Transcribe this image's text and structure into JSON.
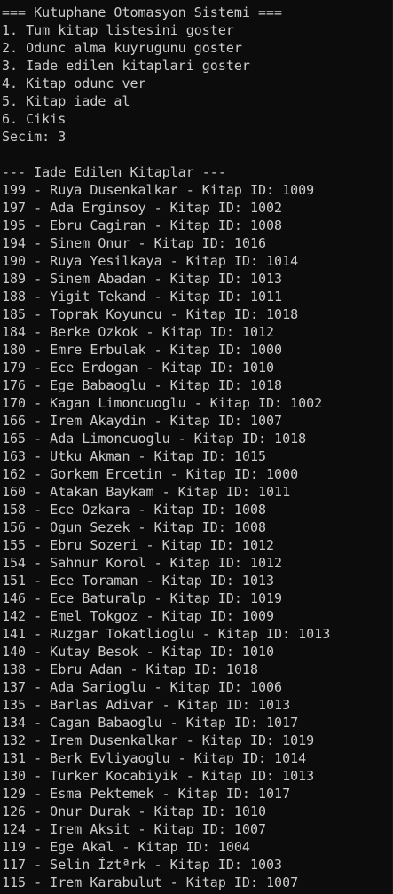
{
  "console": {
    "header": "=== Kutuphane Otomasyon Sistemi ===",
    "menu": [
      "1. Tum kitap listesini goster",
      "2. Odunc alma kuyrugunu goster",
      "3. Iade edilen kitaplari goster",
      "4. Kitap odunc ver",
      "5. Kitap iade al",
      "6. Cikis"
    ],
    "prompt": "Secim: 3",
    "section_title": "--- Iade Edilen Kitaplar ---",
    "returned_books": [
      "199 - Ruya Dusenkalkar - Kitap ID: 1009",
      "197 - Ada Erginsoy - Kitap ID: 1002",
      "195 - Ebru Cagiran - Kitap ID: 1008",
      "194 - Sinem Onur - Kitap ID: 1016",
      "190 - Ruya Yesilkaya - Kitap ID: 1014",
      "189 - Sinem Abadan - Kitap ID: 1013",
      "188 - Yigit Tekand - Kitap ID: 1011",
      "185 - Toprak Koyuncu - Kitap ID: 1018",
      "184 - Berke Ozkok - Kitap ID: 1012",
      "180 - Emre Erbulak - Kitap ID: 1000",
      "179 - Ece Erdogan - Kitap ID: 1010",
      "176 - Ege Babaoglu - Kitap ID: 1018",
      "170 - Kagan Limoncuoglu - Kitap ID: 1002",
      "166 - Irem Akaydin - Kitap ID: 1007",
      "165 - Ada Limoncuoglu - Kitap ID: 1018",
      "163 - Utku Akman - Kitap ID: 1015",
      "162 - Gorkem Ercetin - Kitap ID: 1000",
      "160 - Atakan Baykam - Kitap ID: 1011",
      "158 - Ece Ozkara - Kitap ID: 1008",
      "156 - Ogun Sezek - Kitap ID: 1008",
      "155 - Ebru Sozeri - Kitap ID: 1012",
      "154 - Sahnur Korol - Kitap ID: 1012",
      "151 - Ece Toraman - Kitap ID: 1013",
      "146 - Ece Baturalp - Kitap ID: 1019",
      "142 - Emel Tokgoz - Kitap ID: 1009",
      "141 - Ruzgar Tokatlioglu - Kitap ID: 1013",
      "140 - Kutay Besok - Kitap ID: 1010",
      "138 - Ebru Adan - Kitap ID: 1018",
      "137 - Ada Sarioglu - Kitap ID: 1006",
      "135 - Barlas Adivar - Kitap ID: 1013",
      "134 - Cagan Babaoglu - Kitap ID: 1017",
      "132 - Irem Dusenkalkar - Kitap ID: 1019",
      "131 - Berk Evliyaoglu - Kitap ID: 1014",
      "130 - Turker Kocabiyik - Kitap ID: 1013",
      "129 - Esma Pektemek - Kitap ID: 1017",
      "126 - Onur Durak - Kitap ID: 1010",
      "124 - Irem Aksit - Kitap ID: 1007",
      "119 - Ege Akal - Kitap ID: 1004",
      "117 - Selin Íztªrk - Kitap ID: 1003",
      "115 - Irem Karabulut - Kitap ID: 1007"
    ],
    "colors": {
      "background": "#0c0c0c",
      "text": "#cccccc"
    }
  }
}
